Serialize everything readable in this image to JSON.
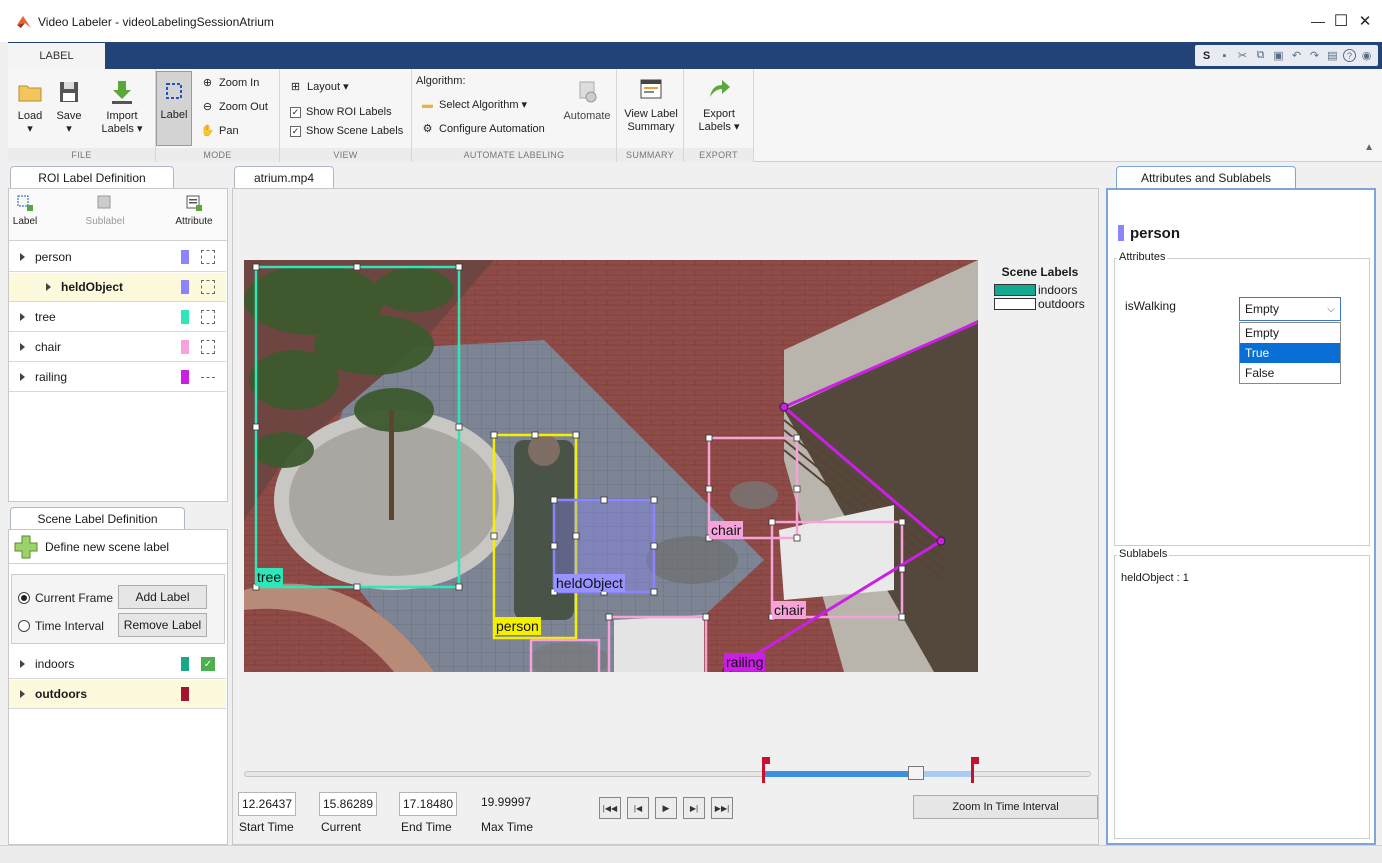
{
  "window": {
    "title": "Video Labeler - videoLabelingSessionAtrium",
    "minimize": "—",
    "maximize": "☐",
    "close": "✕"
  },
  "toolstrip": {
    "tab": "LABEL",
    "qat_letter": "S"
  },
  "ribbon": {
    "file": {
      "title": "FILE",
      "load": "Load",
      "save": "Save",
      "import": "Import",
      "import2": "Labels ▾"
    },
    "mode": {
      "title": "MODE",
      "label": "Label",
      "zoom_in": "Zoom In",
      "zoom_out": "Zoom Out",
      "pan": "Pan"
    },
    "view": {
      "title": "VIEW",
      "layout": "Layout ▾",
      "show_roi": "Show ROI Labels",
      "show_scene": "Show Scene Labels"
    },
    "automate": {
      "title": "AUTOMATE LABELING",
      "algorithm_caption": "Algorithm:",
      "select_algorithm": "Select Algorithm ▾",
      "configure": "Configure Automation",
      "automate": "Automate"
    },
    "summary": {
      "title": "SUMMARY",
      "view_label": "View Label",
      "summary": "Summary"
    },
    "export": {
      "title": "EXPORT",
      "export": "Export",
      "labels": "Labels ▾"
    }
  },
  "roi_panel": {
    "tab": "ROI Label Definition",
    "label_btn": "Label",
    "sublabel_btn": "Sublabel",
    "attribute_btn": "Attribute",
    "items": [
      {
        "name": "person",
        "color": "#8a85ff",
        "shape": "rect"
      },
      {
        "name": "heldObject",
        "color": "#8a85ff",
        "shape": "rect"
      },
      {
        "name": "tree",
        "color": "#2ee6b8",
        "shape": "rect"
      },
      {
        "name": "chair",
        "color": "#f5a3d8",
        "shape": "rect"
      },
      {
        "name": "railing",
        "color": "#cc1fe6",
        "shape": "line"
      }
    ]
  },
  "scene_panel": {
    "tab": "Scene Label Definition",
    "define_new": "Define new scene label",
    "current_frame": "Current Frame",
    "time_interval": "Time Interval",
    "add_label": "Add Label",
    "remove_label": "Remove Label",
    "items": [
      {
        "name": "indoors",
        "color": "#1aa88c",
        "checked": true
      },
      {
        "name": "outdoors",
        "color": "#a3142f",
        "checked": false
      }
    ]
  },
  "video": {
    "tab": "atrium.mp4",
    "scene_labels_title": "Scene Labels",
    "scene_legend": [
      {
        "name": "indoors",
        "color": "#13a890"
      },
      {
        "name": "outdoors",
        "color": "#ffffff"
      }
    ],
    "overlay_labels": {
      "tree": "tree",
      "person": "person",
      "heldObject": "heldObject",
      "chair1": "chair",
      "chair2": "chair",
      "railing": "railing"
    }
  },
  "timeline": {
    "start_time": "12.26437",
    "current": "15.86289",
    "end_time": "17.18480",
    "max_time": "19.99997",
    "start_caption": "Start Time",
    "current_caption": "Current",
    "end_caption": "End Time",
    "max_caption": "Max Time",
    "zoom_btn": "Zoom In Time Interval",
    "slider_start": 0.6132,
    "slider_current": 0.7931,
    "slider_end": 0.8592
  },
  "attributes_panel": {
    "tab": "Attributes and Sublabels",
    "selected_label": "person",
    "selected_color": "#8a85ff",
    "attributes_group": "Attributes",
    "attribute_name": "isWalking",
    "dropdown_value": "Empty",
    "dropdown_options": [
      "Empty",
      "True",
      "False"
    ],
    "dropdown_highlight": "True",
    "sublabels_group": "Sublabels",
    "sublabels_text": "heldObject : 1"
  }
}
